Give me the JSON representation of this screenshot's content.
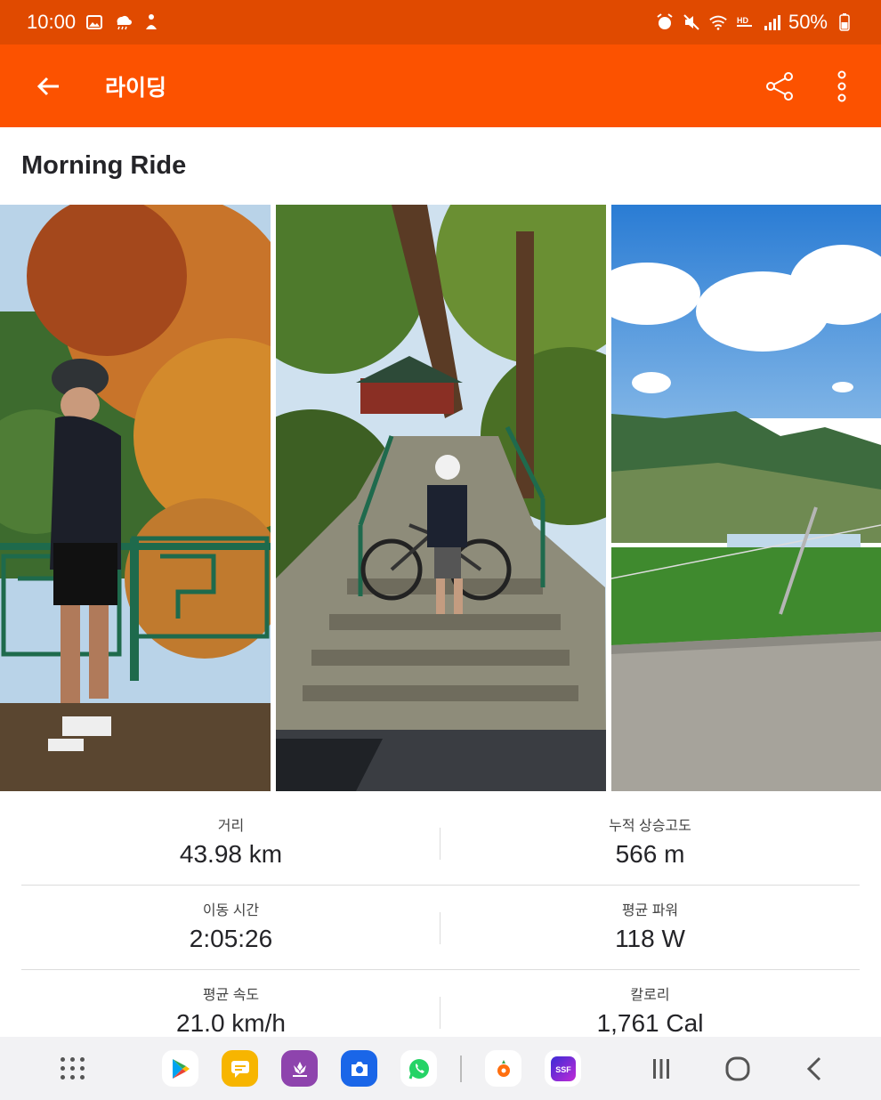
{
  "status_bar": {
    "time": "10:00",
    "battery": "50%",
    "left_icons": [
      "gallery-icon",
      "weather-icon",
      "accessibility-icon"
    ],
    "right_icons": [
      "alarm-icon",
      "mute-icon",
      "wifi-icon",
      "hd-voice-icon",
      "signal-icon",
      "battery-icon"
    ]
  },
  "app_bar": {
    "title": "라이딩",
    "back_icon": "arrow-left-icon",
    "share_icon": "share-icon",
    "more_icon": "more-vertical-icon",
    "color": "#fc5200"
  },
  "activity": {
    "title": "Morning Ride"
  },
  "photos": [
    {
      "subject": "cyclist-autumn-leaves"
    },
    {
      "subject": "cyclist-stone-stairs"
    },
    {
      "subject": "mountain-field-road"
    }
  ],
  "stats": [
    {
      "left": {
        "label": "거리",
        "value": "43.98 km"
      },
      "right": {
        "label": "누적 상승고도",
        "value": "566 m"
      }
    },
    {
      "left": {
        "label": "이동 시간",
        "value": "2:05:26"
      },
      "right": {
        "label": "평균 파워",
        "value": "118 W"
      }
    },
    {
      "left": {
        "label": "평균 속도",
        "value": "21.0 km/h"
      },
      "right": {
        "label": "칼로리",
        "value": "1,761 Cal"
      }
    }
  ],
  "nav_bar": {
    "dock_apps": [
      "play-store-icon",
      "messages-icon",
      "blossom-icon",
      "camera-icon",
      "whatsapp-icon",
      "carrot-icon",
      "ssf-icon"
    ],
    "ssf_label": "SSF",
    "system_buttons": [
      "recents-icon",
      "home-icon",
      "back-nav-icon"
    ]
  }
}
